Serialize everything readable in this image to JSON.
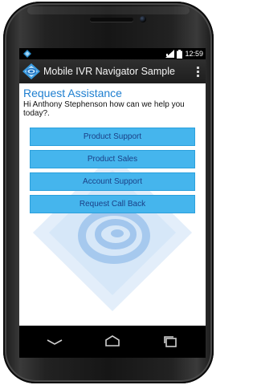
{
  "status_bar": {
    "time": "12:59",
    "left_icon": "notification-diamond-icon",
    "icons": [
      "signal-icon",
      "battery-icon"
    ]
  },
  "action_bar": {
    "title": "Mobile IVR Navigator Sample",
    "logo": "app-logo-icon",
    "overflow": "overflow-menu-icon"
  },
  "main": {
    "heading": "Request Assistance",
    "greeting": "Hi Anthony Stephenson how can we help you today?.",
    "buttons": [
      {
        "label": "Product Support"
      },
      {
        "label": "Product Sales"
      },
      {
        "label": "Account Support"
      },
      {
        "label": "Request Call Back"
      }
    ]
  },
  "nav_bar": {
    "icons": [
      "back-icon",
      "home-icon",
      "recent-apps-icon"
    ]
  },
  "colors": {
    "accent": "#33b5e5",
    "button_bg": "#45b5ed",
    "button_text": "#1a3f86",
    "heading": "#1e7fd0",
    "watermark": "#cfe3f6"
  }
}
